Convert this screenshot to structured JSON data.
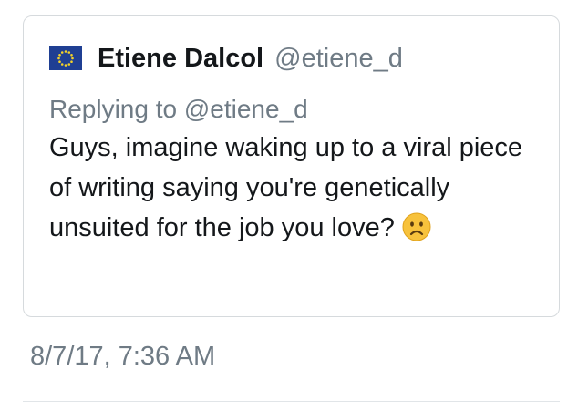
{
  "quoted_tweet": {
    "author": {
      "flag_icon": "eu-flag-icon",
      "name": "Etiene Dalcol",
      "handle": "@etiene_d"
    },
    "replying_to": "Replying to @etiene_d",
    "text": "Guys, imagine waking up to a viral piece of writing saying you're genetically unsuited for the job you love?",
    "emoji": "frowning-face-emoji"
  },
  "timestamp": "8/7/17, 7:36 AM",
  "colors": {
    "primary_text": "#14171a",
    "secondary_text": "#6f7b85",
    "border": "#d6dadd",
    "flag_blue": "#1f3f93",
    "flag_star": "#f5d328",
    "emoji_face": "#f7c23c"
  }
}
